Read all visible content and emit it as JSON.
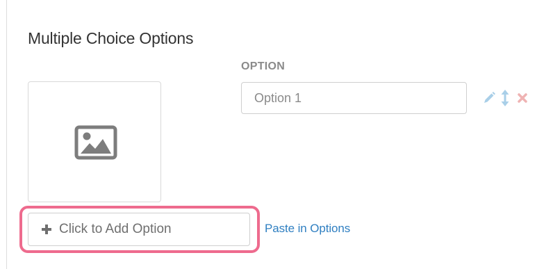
{
  "section": {
    "title": "Multiple Choice Options"
  },
  "options": {
    "column_header": "OPTION",
    "rows": [
      {
        "value": "Option 1"
      }
    ]
  },
  "actions": {
    "add_option_label": "Click to Add Option",
    "paste_options_label": "Paste in Options"
  },
  "icons": {
    "image_placeholder": "image-icon",
    "edit": "pencil-icon",
    "reorder": "move-vertical-icon",
    "delete": "close-icon",
    "add": "plus-icon"
  },
  "colors": {
    "highlight": "#ee6b8e",
    "link": "#2f7fc1",
    "edit_icon": "#a9cfe8",
    "delete_icon": "#efb3b3",
    "image_icon": "#7d7d7d"
  }
}
